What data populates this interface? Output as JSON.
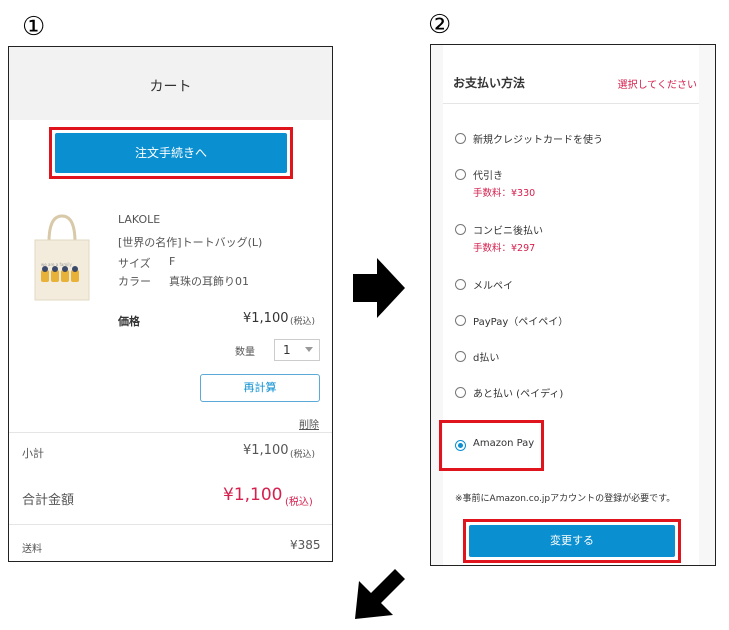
{
  "steps": {
    "one": "①",
    "two": "②"
  },
  "cart": {
    "title": "カート",
    "checkout_button": "注文手続きへ",
    "item": {
      "brand": "LAKOLE",
      "name": "[世界の名作]トートバッグ(L)",
      "size_label": "サイズ",
      "size_value": "F",
      "color_label": "カラー",
      "color_value": "真珠の耳飾り01",
      "price_label": "価格",
      "price_value": "¥1,100",
      "tax_note": "(税込)",
      "qty_label": "数量",
      "qty_value": "1",
      "recalc_button": "再計算",
      "delete_link": "削除"
    },
    "subtotal_label": "小計",
    "subtotal_value": "¥1,100",
    "subtotal_tax": "(税込)",
    "total_label": "合計金額",
    "total_value": "¥1,100",
    "total_tax": "(税込)",
    "shipping_label": "送料",
    "shipping_value": "¥385"
  },
  "payment": {
    "title": "お支払い方法",
    "select_prompt": "選択してください",
    "options": [
      {
        "label": "新規クレジットカードを使う",
        "fee": ""
      },
      {
        "label": "代引き",
        "fee": "手数料：¥330"
      },
      {
        "label": "コンビニ後払い",
        "fee": "手数料：¥297"
      },
      {
        "label": "メルペイ",
        "fee": ""
      },
      {
        "label": "PayPay（ペイペイ）",
        "fee": ""
      },
      {
        "label": "d払い",
        "fee": ""
      },
      {
        "label": "あと払い (ペイディ)",
        "fee": ""
      },
      {
        "label": "Amazon Pay",
        "fee": ""
      }
    ],
    "selected": "Amazon Pay",
    "note": "※事前にAmazon.co.jpアカウントの登録が必要です。",
    "change_button": "変更する"
  },
  "colors": {
    "accent_blue": "#0a8fd1",
    "highlight_red": "#e0141c",
    "price_pink": "#d6204e"
  },
  "icons": {
    "next": "right-arrow-icon",
    "down": "down-left-arrow-icon"
  }
}
